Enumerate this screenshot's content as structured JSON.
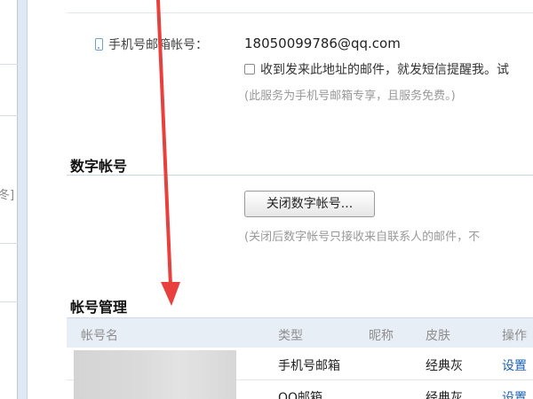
{
  "sidebar": {
    "fragment_text": "冬]"
  },
  "phone_mail": {
    "label": "手机号邮箱帐号：",
    "email": "18050099786@qq.com",
    "notify_text": "收到发来此地址的邮件，就发短信提醒我。试",
    "note": "(此服务为手机号邮箱专享，且服务免费。)"
  },
  "digital_account": {
    "title": "数字帐号",
    "close_button": "关闭数字帐号...",
    "note": "(关闭后数字帐号只接收来自联系人的邮件，不"
  },
  "account_management": {
    "title": "帐号管理",
    "columns": [
      "帐号名",
      "类型",
      "昵称",
      "皮肤",
      "操作"
    ],
    "rows": [
      {
        "type": "手机号邮箱",
        "skin": "经典灰",
        "action": "设置"
      },
      {
        "type": "QQ邮箱",
        "skin": "经典灰",
        "action": "设置"
      }
    ]
  },
  "colors": {
    "annotation_arrow": "#e8403d",
    "link": "#1a62b5",
    "header_bg": "#e8eef6"
  }
}
